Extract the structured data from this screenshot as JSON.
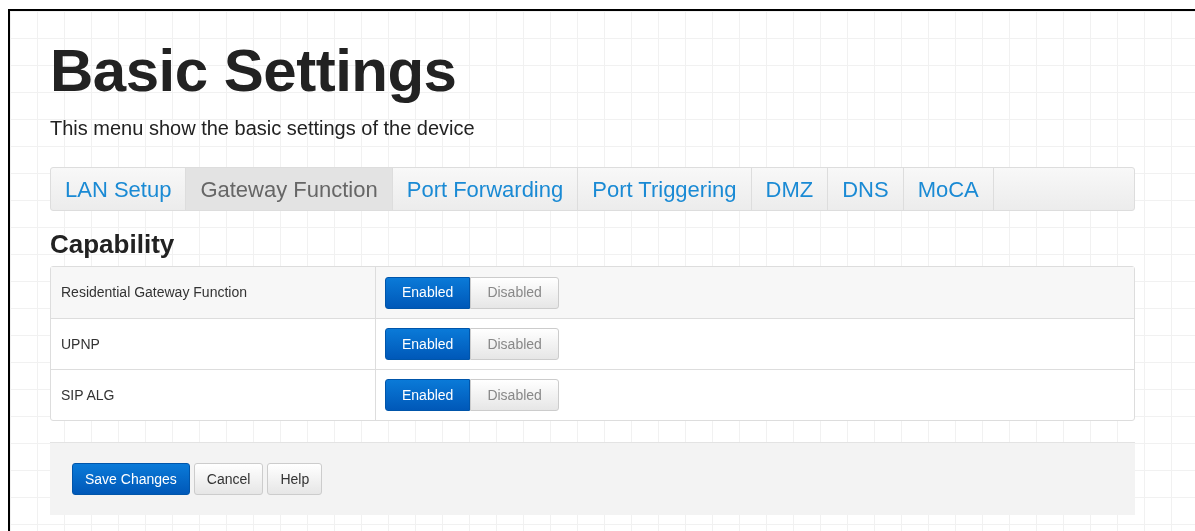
{
  "page": {
    "title": "Basic Settings",
    "subtitle": "This menu show the basic settings of the device"
  },
  "tabs": [
    {
      "label": "LAN Setup",
      "selected": false
    },
    {
      "label": "Gateway Function",
      "selected": true
    },
    {
      "label": "Port Forwarding",
      "selected": false
    },
    {
      "label": "Port Triggering",
      "selected": false
    },
    {
      "label": "DMZ",
      "selected": false
    },
    {
      "label": "DNS",
      "selected": false
    },
    {
      "label": "MoCA",
      "selected": false
    }
  ],
  "section": {
    "title": "Capability"
  },
  "settings": [
    {
      "label": "Residential Gateway Function",
      "options": [
        {
          "label": "Enabled",
          "selected": true
        },
        {
          "label": "Disabled",
          "selected": false
        }
      ]
    },
    {
      "label": "UPNP",
      "options": [
        {
          "label": "Enabled",
          "selected": true
        },
        {
          "label": "Disabled",
          "selected": false
        }
      ]
    },
    {
      "label": "SIP ALG",
      "options": [
        {
          "label": "Enabled",
          "selected": true
        },
        {
          "label": "Disabled",
          "selected": false
        }
      ]
    }
  ],
  "buttons": [
    {
      "label": "Save Changes",
      "kind": "primary"
    },
    {
      "label": "Cancel",
      "kind": "default"
    },
    {
      "label": "Help",
      "kind": "default"
    }
  ]
}
